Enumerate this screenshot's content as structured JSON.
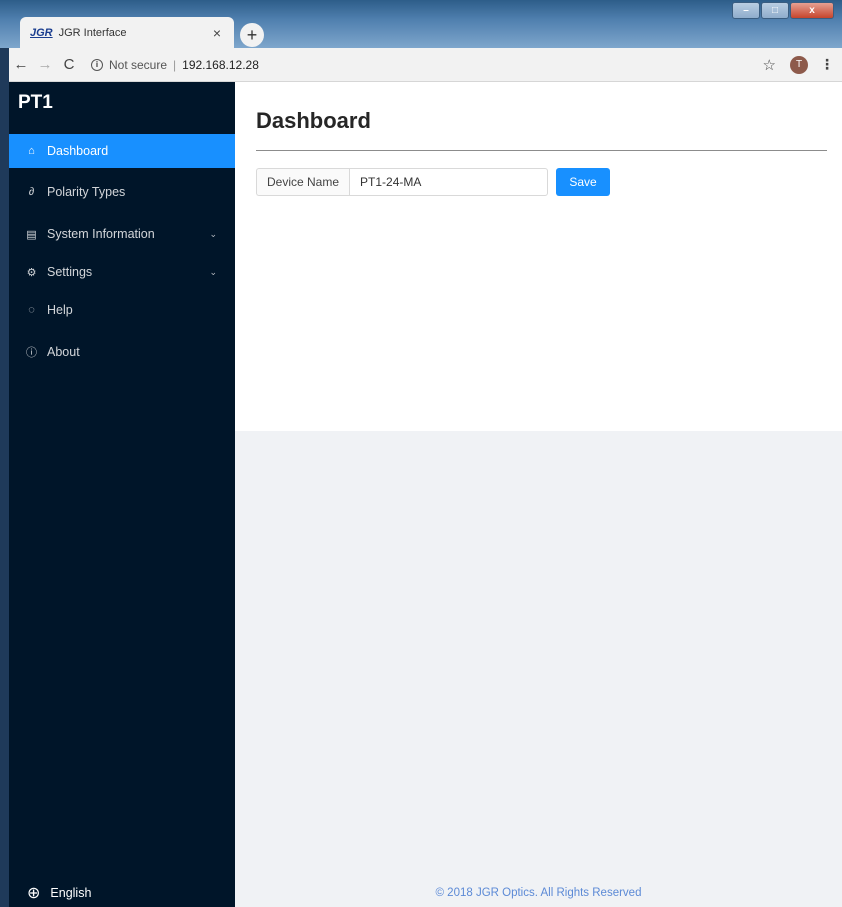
{
  "browser": {
    "tab_logo": "JGR",
    "tab_title": "JGR Interface",
    "tab_close": "×",
    "new_tab": "+",
    "window_buttons": {
      "minimize": "–",
      "maximize": "□",
      "close": "x"
    },
    "nav": {
      "back": "←",
      "forward": "→",
      "reload": "C"
    },
    "security_icon": "i",
    "security_text": "Not secure",
    "separator": "|",
    "url": "192.168.12.28",
    "bookmark": "☆",
    "profile_initial": "T",
    "menu": "⋮"
  },
  "sidebar": {
    "brand": "PT1",
    "items": [
      {
        "label": "Dashboard",
        "icon": "home-icon",
        "glyph": "⌂",
        "active": true
      },
      {
        "label": "Polarity Types",
        "icon": "link-icon",
        "glyph": "∂"
      },
      {
        "label": "System Information",
        "icon": "document-icon",
        "glyph": "▤",
        "chevron": "⌄"
      },
      {
        "label": "Settings",
        "icon": "gear-icon",
        "glyph": "⚙",
        "chevron": "⌄"
      },
      {
        "label": "Help",
        "icon": "message-icon",
        "glyph": "◌"
      },
      {
        "label": "About",
        "icon": "info-circle-icon",
        "glyph": "ⓘ"
      }
    ],
    "language": {
      "label": "English",
      "icon": "globe-icon",
      "glyph": "⊕"
    }
  },
  "main": {
    "title": "Dashboard",
    "device_name_label": "Device Name",
    "device_name_value": "PT1-24-MA",
    "save_label": "Save",
    "footer": "© 2018 JGR Optics. All Rights Reserved"
  },
  "colors": {
    "sidebar_bg": "#001529",
    "accent": "#1890ff",
    "main_bg": "#f0f2f5",
    "footer_text": "#5c8ad6"
  }
}
